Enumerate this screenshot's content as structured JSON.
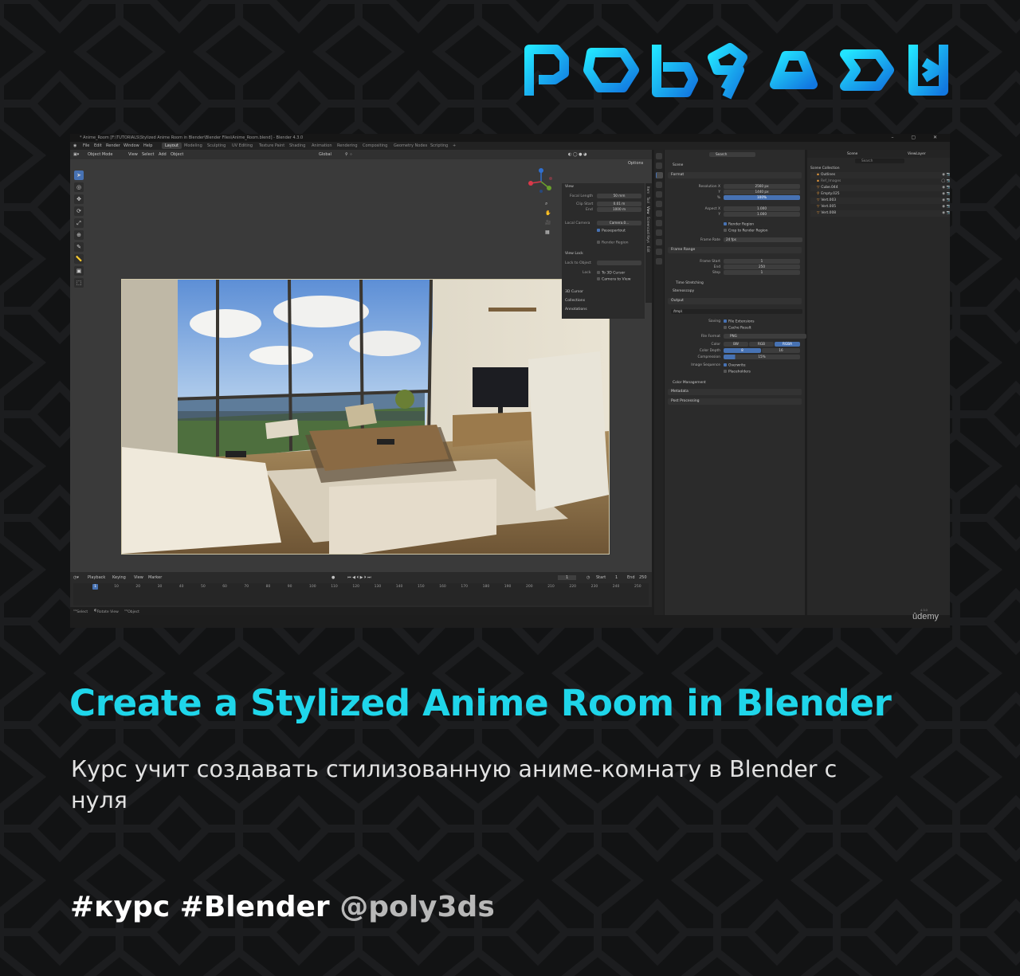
{
  "brand": {
    "logo_name": "poly3ds"
  },
  "screenshot": {
    "window_title": "* Anime_Room [F:\\TUTORIALS\\Stylized Anime Room in Blender\\Blender Files\\Anime_Room.blend] - Blender 4.3.0",
    "menu": [
      "File",
      "Edit",
      "Render",
      "Window",
      "Help"
    ],
    "workspaces": [
      "Layout",
      "Modeling",
      "Sculpting",
      "UV Editing",
      "Texture Paint",
      "Shading",
      "Animation",
      "Rendering",
      "Compositing",
      "Geometry Nodes",
      "Scripting",
      "+"
    ],
    "active_workspace": "Layout",
    "viewport_header": {
      "mode": "Object Mode",
      "items": [
        "View",
        "Select",
        "Add",
        "Object"
      ],
      "orientation": "Global",
      "options": "Options"
    },
    "npanel": {
      "view_section": "View",
      "focal_length_label": "Focal Length",
      "focal_length": "50 mm",
      "clip_start_label": "Clip Start",
      "clip_start": "0.01 m",
      "clip_end_label": "End",
      "clip_end": "1000 m",
      "local_camera_label": "Local Camera",
      "local_camera": "Camera.0...",
      "passepartout": "Passepartout",
      "render_region": "Render Region",
      "view_lock_section": "View Lock",
      "lock_to_object_label": "Lock to Object",
      "lock_label": "Lock",
      "to_3d_cursor": "To 3D Cursor",
      "camera_to_view": "Camera to View",
      "cursor_section": "3D Cursor",
      "collections_section": "Collections",
      "annotations_section": "Annotations",
      "tabs": [
        "Item",
        "Tool",
        "View",
        "Screencast Keys",
        "Edit"
      ]
    },
    "timeline": {
      "menus": [
        "Playback",
        "Keying",
        "View",
        "Marker"
      ],
      "current_frame": "1",
      "start_label": "Start",
      "start": "1",
      "end_label": "End",
      "end": "250",
      "ruler": [
        "1",
        "10",
        "20",
        "30",
        "40",
        "50",
        "60",
        "70",
        "80",
        "90",
        "100",
        "110",
        "120",
        "130",
        "140",
        "150",
        "160",
        "170",
        "180",
        "190",
        "200",
        "210",
        "220",
        "230",
        "240",
        "250"
      ]
    },
    "statusbar": [
      "Select",
      "Rotate View",
      "Object"
    ],
    "properties": {
      "search_placeholder": "Search",
      "scene_label": "Scene",
      "format_section": "Format",
      "resolution_x_label": "Resolution X",
      "resolution_x": "2560 px",
      "resolution_y_label": "Y",
      "resolution_y": "1440 px",
      "resolution_pct_label": "%",
      "resolution_pct": "100%",
      "aspect_x_label": "Aspect X",
      "aspect_x": "1.000",
      "aspect_y_label": "Y",
      "aspect_y": "1.000",
      "render_region": "Render Region",
      "crop_to_render_region": "Crop to Render Region",
      "frame_rate_label": "Frame Rate",
      "frame_rate": "24 fps",
      "frame_range_section": "Frame Range",
      "frame_start_label": "Frame Start",
      "frame_start": "1",
      "frame_end_label": "End",
      "frame_end": "250",
      "frame_step_label": "Step",
      "frame_step": "1",
      "time_stretching": "Time Stretching",
      "stereoscopy": "Stereoscopy",
      "output_section": "Output",
      "output_path": "/tmp\\",
      "saving_label": "Saving",
      "file_extensions": "File Extensions",
      "cache_result": "Cache Result",
      "file_format_label": "File Format",
      "file_format": "PNG",
      "color_label": "Color",
      "color_options": [
        "BW",
        "RGB",
        "RGBA"
      ],
      "color_selected": "RGBA",
      "color_depth_label": "Color Depth",
      "color_depth_options": [
        "8",
        "16"
      ],
      "color_depth_selected": "8",
      "compression_label": "Compression",
      "compression": "15%",
      "image_sequence_label": "Image Sequence",
      "overwrite": "Overwrite",
      "placeholders": "Placeholders",
      "color_management": "Color Management",
      "metadata_section": "Metadata",
      "post_processing_section": "Post Processing"
    },
    "outliner": {
      "view_layer": "ViewLayer",
      "scene": "Scene",
      "search_placeholder": "Search",
      "items": [
        "Scene Collection",
        "Outlines",
        "Ref_Images",
        "Cube.044",
        "Empty.025",
        "Vert.003",
        "Vert.005",
        "Vert.008"
      ]
    },
    "udemy": {
      "label": "ûdemy",
      "version": "4.3.0"
    }
  },
  "headline": "Create a Stylized Anime Room in Blender",
  "description": "Курс учит создавать стилизованную аниме-комнату в Blender с нуля",
  "hashtags": "#курс #Blender",
  "handle": "@poly3ds",
  "colors": {
    "accent": "#1fd6ea",
    "background": "#121314",
    "blender_blue": "#4772b3"
  }
}
